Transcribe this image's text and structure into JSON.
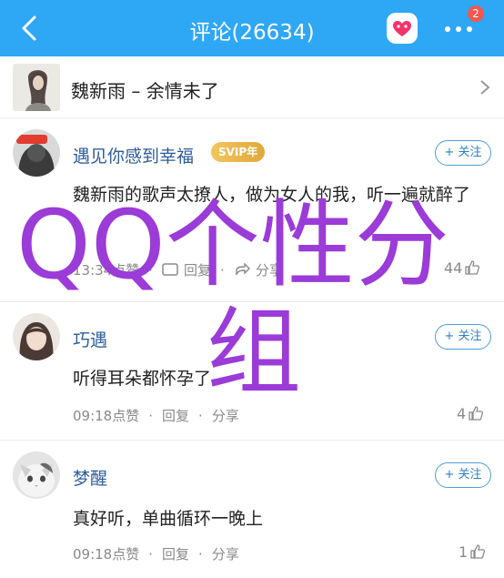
{
  "header": {
    "back_icon": "chevron-left-icon",
    "title": "评论(26634)",
    "qq_icon": "heart-chat-icon",
    "more_icon": "more-dots-icon",
    "badge": "2",
    "color": "#2ea7f5"
  },
  "song": {
    "title": "魏新雨 – 余情未了"
  },
  "comments": [
    {
      "user": "遇见你感到幸福",
      "vip": "SVIP年",
      "follow": "+ 关注",
      "text": "魏新雨的歌声太撩人，做为女人的我，听一遍就醉了",
      "time": "13:34",
      "like_text": "点赞",
      "reply_text": "回复",
      "share_text": "分享",
      "likes": "44"
    },
    {
      "user": "巧遇",
      "follow": "+ 关注",
      "text": "听得耳朵都怀孕了",
      "time": "09:18",
      "like_text": "点赞",
      "reply_text": "回复",
      "share_text": "分享",
      "likes": "4"
    },
    {
      "user": "梦醒",
      "follow": "+ 关注",
      "text": "真好听，单曲循环一晚上",
      "time": "09:18",
      "like_text": "点赞",
      "reply_text": "回复",
      "share_text": "分享",
      "likes": "1"
    }
  ],
  "watermark": {
    "line1": "QQ个性分",
    "line2": "组",
    "color": "#9b3bd8"
  }
}
